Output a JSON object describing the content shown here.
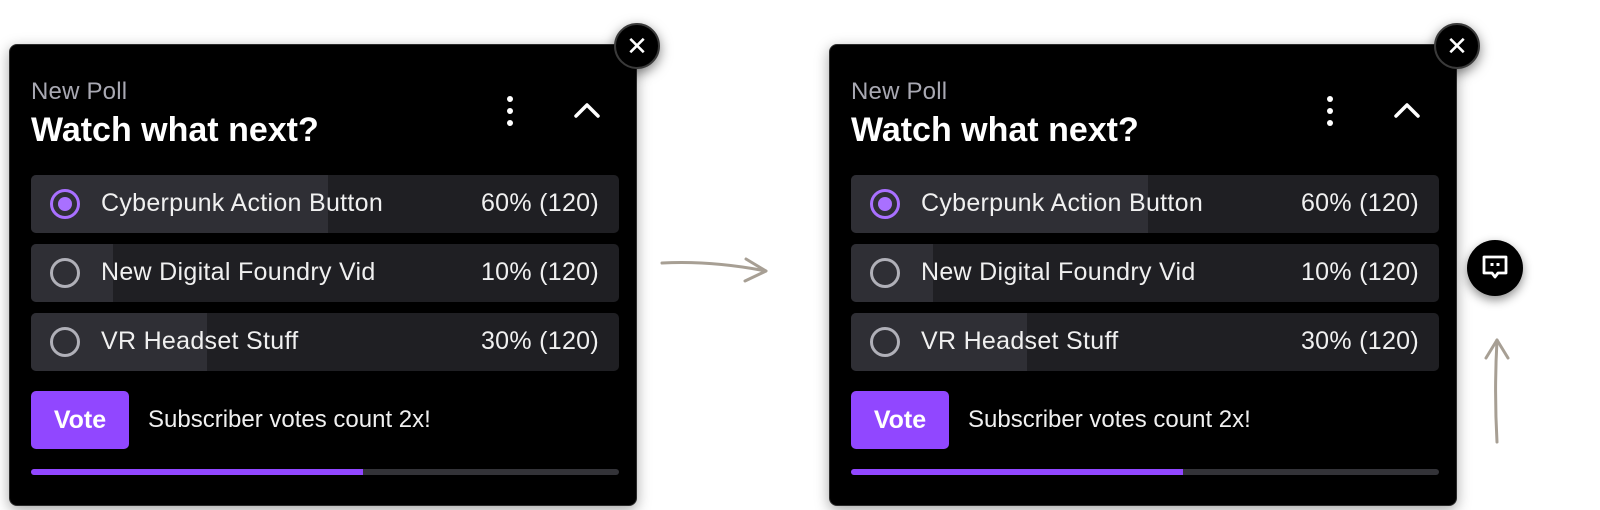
{
  "colors": {
    "accent": "#9147ff",
    "radio_selected": "#a970ff",
    "panel_bg": "#000000",
    "option_bg": "#1f1f23",
    "option_fill": "#2f2f35",
    "arrow": "#a79f94"
  },
  "icons": {
    "close": "close-icon",
    "more": "more-vertical-icon",
    "collapse": "chevron-up-icon",
    "chat": "chat-bubble-icon",
    "flow_arrow": "arrow-icon"
  },
  "panels": [
    {
      "kicker": "New Poll",
      "title": "Watch what next?",
      "options": [
        {
          "label": "Cyberpunk Action Button",
          "result": "60% (120)",
          "fill": 0.505,
          "selected": true
        },
        {
          "label": "New Digital Foundry Vid",
          "result": "10% (120)",
          "fill": 0.14,
          "selected": false
        },
        {
          "label": "VR Headset Stuff",
          "result": "30% (120)",
          "fill": 0.3,
          "selected": false
        }
      ],
      "vote_label": "Vote",
      "note": "Subscriber votes count 2x!",
      "progress": 0.565
    },
    {
      "kicker": "New Poll",
      "title": "Watch what next?",
      "options": [
        {
          "label": "Cyberpunk Action Button",
          "result": "60% (120)",
          "fill": 0.505,
          "selected": true
        },
        {
          "label": "New Digital Foundry Vid",
          "result": "10% (120)",
          "fill": 0.14,
          "selected": false
        },
        {
          "label": "VR Headset Stuff",
          "result": "30% (120)",
          "fill": 0.3,
          "selected": false
        }
      ],
      "vote_label": "Vote",
      "note": "Subscriber votes count 2x!",
      "progress": 0.565
    }
  ]
}
